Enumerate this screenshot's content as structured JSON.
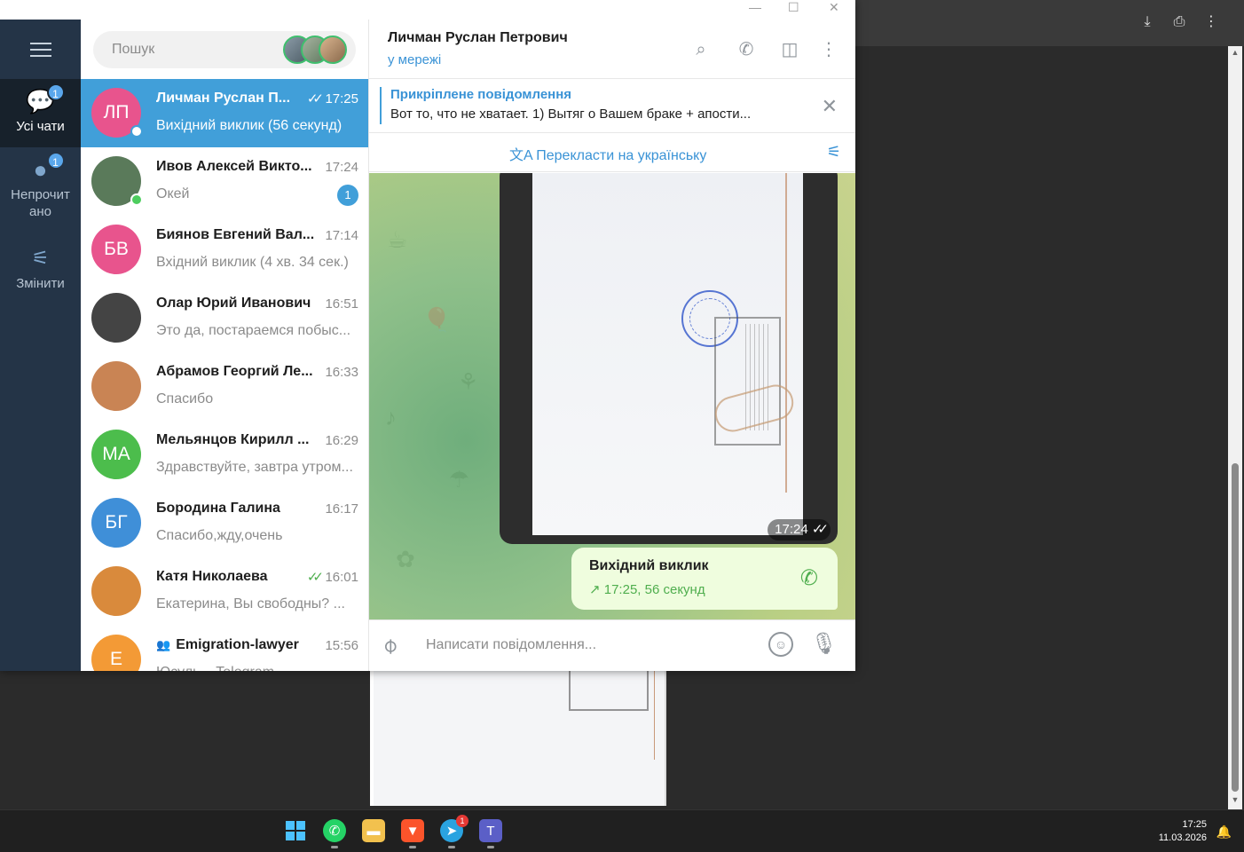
{
  "browser": {
    "icons": [
      "download-icon",
      "print-icon",
      "more-icon"
    ]
  },
  "taskbar": {
    "apps": [
      "windows-start",
      "whatsapp",
      "file-explorer",
      "brave",
      "telegram",
      "teams"
    ],
    "telegram_badge": "1",
    "time": "17:25",
    "date": "11.03.2026"
  },
  "rail": {
    "folders": [
      {
        "label": "Усі чати",
        "badge": "1"
      },
      {
        "label": "Непрочитано",
        "badge": "1"
      },
      {
        "label": "Змінити"
      }
    ]
  },
  "search": {
    "placeholder": "Пошук"
  },
  "chats": [
    {
      "initials": "ЛП",
      "name": "Личман Руслан П...",
      "time": "17:25",
      "preview": "Вихідний виклик (56 секунд)",
      "color": "#e8548d",
      "ticks": "✓✓",
      "online": true
    },
    {
      "initials": "",
      "name": "Ивов Алексей Викто...",
      "time": "17:24",
      "preview": "Окей",
      "unread": "1",
      "color": "#5a7a5a",
      "online": true
    },
    {
      "initials": "БВ",
      "name": "Биянов Евгений Вал...",
      "time": "17:14",
      "preview": "Вхідний виклик (4 хв. 34 сек.)",
      "color": "#e8548d"
    },
    {
      "initials": "",
      "name": "Олар Юрий Иванович",
      "time": "16:51",
      "preview": "Это да, постараемся побыс...",
      "color": "#444"
    },
    {
      "initials": "",
      "name": "Абрамов Георгий Ле...",
      "time": "16:33",
      "preview": "Спасибо",
      "color": "#c98454"
    },
    {
      "initials": "МА",
      "name": "Мельянцов Кирилл ...",
      "time": "16:29",
      "preview": "Здравствуйте, завтра утром...",
      "color": "#4cbd4c"
    },
    {
      "initials": "БГ",
      "name": "Бородина Галина",
      "time": "16:17",
      "preview": "Спасибо,жду,очень",
      "color": "#3f8fd8"
    },
    {
      "initials": "",
      "name": "Катя Николаева",
      "time": "16:01",
      "preview": "Екатерина, Вы свободны? ...",
      "color": "#d98a3c",
      "ticks": "✓✓"
    },
    {
      "initials": "Е",
      "name": "Emigration-lawyer",
      "time": "15:56",
      "preview": "Юсуль... Telegram",
      "color": "#f39a36",
      "group": true
    }
  ],
  "conversation": {
    "title": "Личман Руслан Петрович",
    "status": "у мережі",
    "pinned_title": "Прикріплене повідомлення",
    "pinned_text": "Вот то, что не хватает.  1) Вытяг о Вашем браке + апости...",
    "translate": "Перекласти на українську",
    "photo_time": "17:24",
    "call_title": "Вихідний виклик",
    "call_detail": "17:25, 56 секунд",
    "composer_placeholder": "Написати повідомлення..."
  },
  "colors": {
    "accent": "#419fd9",
    "rail": "#243447",
    "online": "#4dcd5e"
  }
}
